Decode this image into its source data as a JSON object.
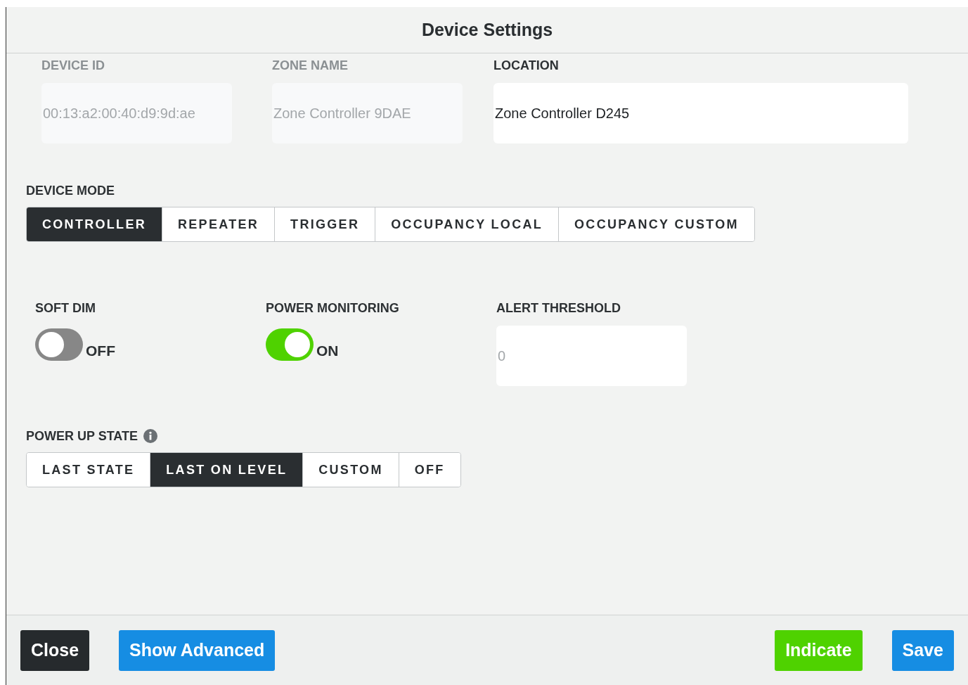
{
  "window": {
    "title": "Device Settings"
  },
  "fields": [
    {
      "label": "DEVICE ID",
      "value": "00:13:a2:00:40:d9:9d:ae",
      "disabled": true
    },
    {
      "label": "ZONE NAME",
      "value": "Zone Controller 9DAE",
      "disabled": true
    },
    {
      "label": "LOCATION",
      "value": "Zone Controller D245",
      "disabled": false
    }
  ],
  "device_mode": {
    "label": "DEVICE MODE",
    "options": [
      {
        "label": "CONTROLLER",
        "selected": true
      },
      {
        "label": "REPEATER",
        "selected": false
      },
      {
        "label": "TRIGGER",
        "selected": false
      },
      {
        "label": "OCCUPANCY LOCAL",
        "selected": false
      },
      {
        "label": "OCCUPANCY CUSTOM",
        "selected": false
      }
    ]
  },
  "toggles": [
    {
      "label": "SOFT DIM",
      "on": false,
      "state_label": "OFF"
    },
    {
      "label": "POWER MONITORING",
      "on": true,
      "state_label": "ON"
    }
  ],
  "alert_threshold": {
    "label": "ALERT THRESHOLD",
    "placeholder": "0"
  },
  "power_up_state": {
    "label": "POWER UP STATE",
    "options": [
      {
        "label": "LAST STATE",
        "selected": false
      },
      {
        "label": "LAST ON LEVEL",
        "selected": true
      },
      {
        "label": "CUSTOM",
        "selected": false
      },
      {
        "label": "OFF",
        "selected": false
      }
    ]
  },
  "footer": {
    "left": [
      {
        "label": "Close",
        "kind": "dark"
      },
      {
        "label": "Show Advanced",
        "kind": "primary"
      }
    ],
    "right": [
      {
        "label": "Indicate",
        "kind": "success"
      },
      {
        "label": "Save",
        "kind": "primary"
      }
    ]
  }
}
